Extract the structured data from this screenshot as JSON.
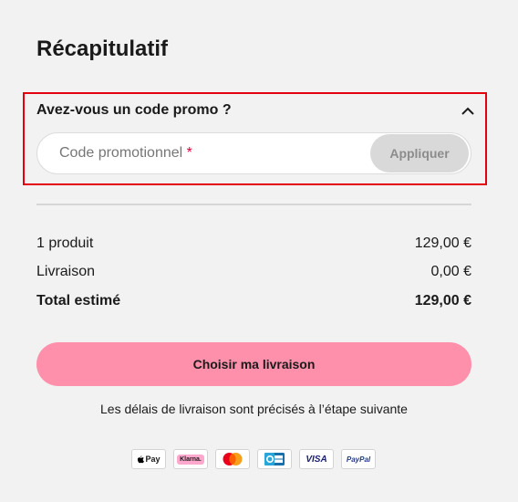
{
  "summary": {
    "title": "Récapitulatif",
    "promo": {
      "title": "Avez-vous un code promo ?",
      "expanded_icon": "chevron-up-icon",
      "input_placeholder": "Code promotionnel",
      "required_mark": "*",
      "apply_label": "Appliquer"
    },
    "rows": [
      {
        "label": "1 produit",
        "value": "129,00 €"
      },
      {
        "label": "Livraison",
        "value": "0,00 €"
      },
      {
        "label": "Total estimé",
        "value": "129,00 €"
      }
    ],
    "cta_label": "Choisir ma livraison",
    "delivery_note": "Les délais de livraison sont précisés à l’étape suivante"
  },
  "payment_methods": [
    {
      "name": "apple-pay-icon",
      "text": "Pay"
    },
    {
      "name": "klarna-icon",
      "text": "Klarna."
    },
    {
      "name": "mastercard-icon",
      "text": ""
    },
    {
      "name": "carte-bancaire-icon",
      "text": ""
    },
    {
      "name": "visa-icon",
      "text": "VISA"
    },
    {
      "name": "paypal-icon",
      "text": "PayPal"
    }
  ],
  "colors": {
    "background": "#f2f2f2",
    "highlight_border": "#e4000f",
    "cta": "#ff90ab",
    "required": "#e4003a",
    "apply_disabled": "#d9d9d9"
  }
}
